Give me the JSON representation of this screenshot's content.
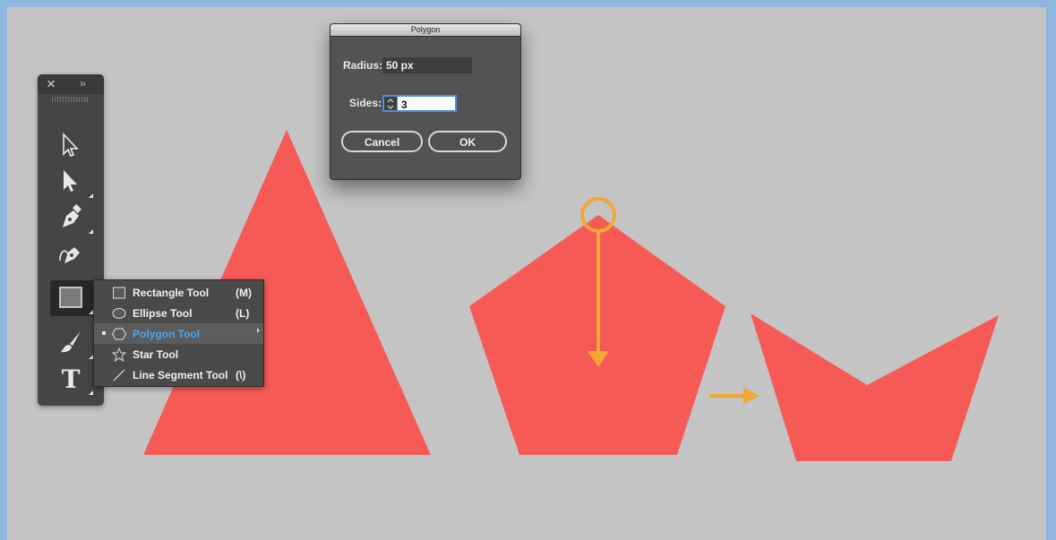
{
  "colors": {
    "frame": "#8fb6df",
    "canvas": "#c4c4c4",
    "shape_fill": "#f65a56",
    "annotation": "#f3a733",
    "selection_blue": "#4aa6f0"
  },
  "toolbar": {
    "close_icon": "×",
    "expand_icon": "››",
    "tools": [
      {
        "name": "selection-tool",
        "icon": "arrow-outline-icon"
      },
      {
        "name": "direct-selection-tool",
        "icon": "arrow-filled-icon"
      },
      {
        "name": "pen-tool",
        "icon": "pen-icon"
      },
      {
        "name": "curvature-tool",
        "icon": "curvature-pen-icon"
      },
      {
        "name": "rectangle-tool",
        "icon": "rectangle-icon",
        "selected": true
      },
      {
        "name": "paintbrush-tool",
        "icon": "brush-icon"
      },
      {
        "name": "type-tool",
        "icon": "type-icon",
        "glyph": "T"
      }
    ]
  },
  "flyout": {
    "items": [
      {
        "label": "Rectangle Tool",
        "shortcut": "(M)",
        "icon": "rectangle-icon"
      },
      {
        "label": "Ellipse Tool",
        "shortcut": "(L)",
        "icon": "ellipse-icon"
      },
      {
        "label": "Polygon Tool",
        "shortcut": "",
        "icon": "hexagon-icon",
        "active": true
      },
      {
        "label": "Star Tool",
        "shortcut": "",
        "icon": "star-icon"
      },
      {
        "label": "Line Segment Tool",
        "shortcut": "(\\)",
        "icon": "line-icon"
      }
    ]
  },
  "dialog": {
    "title": "Polygon",
    "radius_label": "Radius:",
    "radius_value": "50 px",
    "sides_label": "Sides:",
    "sides_value": "3",
    "cancel_label": "Cancel",
    "ok_label": "OK"
  }
}
